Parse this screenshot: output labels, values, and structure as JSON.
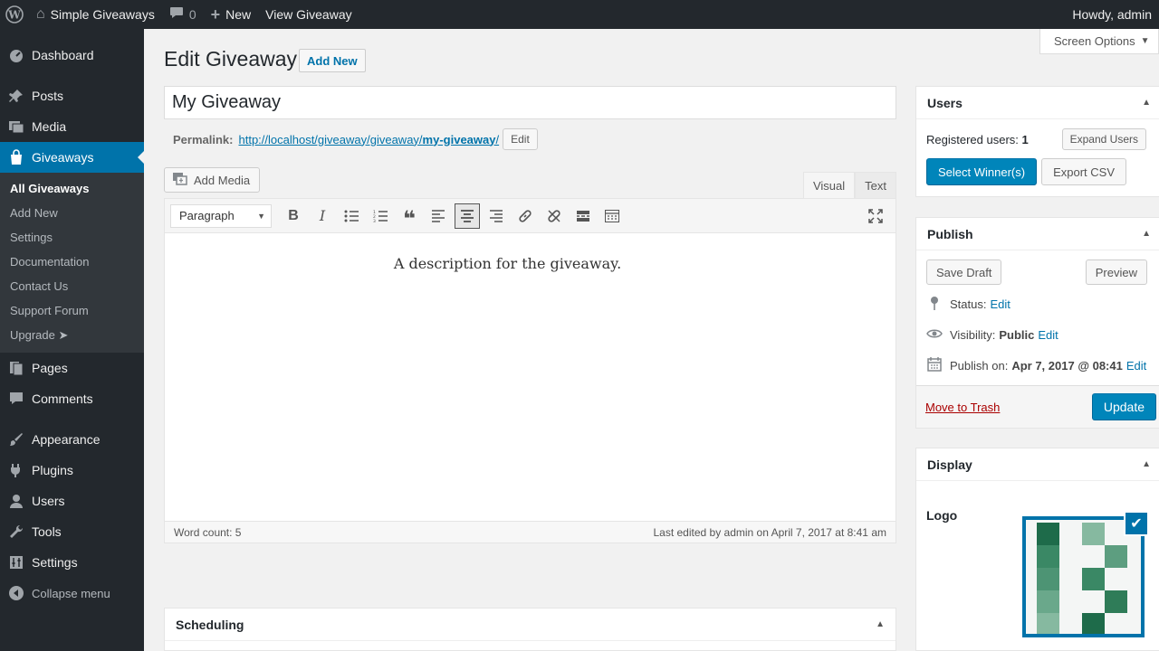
{
  "adminbar": {
    "site_name": "Simple Giveaways",
    "comments_count": "0",
    "new_label": "New",
    "view_label": "View Giveaway",
    "howdy": "Howdy, admin"
  },
  "sidebar": {
    "items": [
      {
        "label": "Dashboard"
      },
      {
        "label": "Posts"
      },
      {
        "label": "Media"
      },
      {
        "label": "Giveaways"
      },
      {
        "label": "Pages"
      },
      {
        "label": "Comments"
      },
      {
        "label": "Appearance"
      },
      {
        "label": "Plugins"
      },
      {
        "label": "Users"
      },
      {
        "label": "Tools"
      },
      {
        "label": "Settings"
      },
      {
        "label": "Collapse menu"
      }
    ],
    "submenu": [
      {
        "label": "All Giveaways"
      },
      {
        "label": "Add New"
      },
      {
        "label": "Settings"
      },
      {
        "label": "Documentation"
      },
      {
        "label": "Contact Us"
      },
      {
        "label": "Support Forum"
      },
      {
        "label": "Upgrade ➤"
      }
    ]
  },
  "screen_options": "Screen Options",
  "page": {
    "title": "Edit Giveaway",
    "add_new": "Add New",
    "post_title": "My Giveaway",
    "permalink_label": "Permalink:",
    "permalink_base": "http://localhost/giveaway/giveaway/",
    "permalink_slug": "my-giveaway",
    "permalink_trail": "/",
    "permalink_edit": "Edit"
  },
  "editor": {
    "add_media": "Add Media",
    "tab_visual": "Visual",
    "tab_text": "Text",
    "format": "Paragraph",
    "content": "A description for the giveaway.",
    "word_count": "Word count: 5",
    "last_edited": "Last edited by admin on April 7, 2017 at 8:41 am"
  },
  "scheduling": {
    "title": "Scheduling"
  },
  "users_box": {
    "title": "Users",
    "registered_label": "Registered users:",
    "registered_count": "1",
    "expand": "Expand Users",
    "select_winners": "Select Winner(s)",
    "export_csv": "Export CSV"
  },
  "publish_box": {
    "title": "Publish",
    "save_draft": "Save Draft",
    "preview": "Preview",
    "status_label": "Status:",
    "status_edit": "Edit",
    "visibility_label": "Visibility:",
    "visibility_value": "Public",
    "visibility_edit": "Edit",
    "publish_label": "Publish on:",
    "publish_value": "Apr 7, 2017 @ 08:41",
    "publish_edit": "Edit",
    "trash": "Move to Trash",
    "update": "Update"
  },
  "display_box": {
    "title": "Display",
    "logo_label": "Logo"
  },
  "colors": {
    "accent": "#0073aa",
    "primary_button": "#0085ba",
    "sidebar_bg": "#23282d",
    "trash": "#a00000"
  }
}
